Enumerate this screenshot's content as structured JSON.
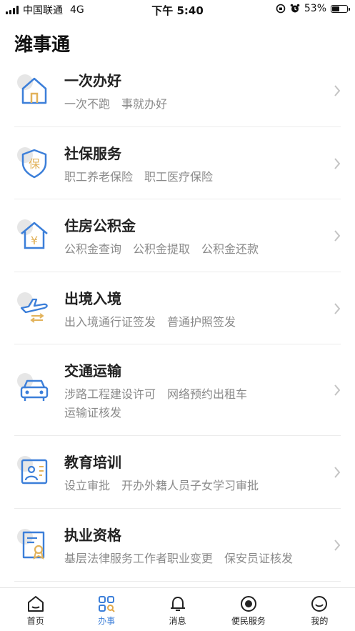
{
  "status_bar": {
    "carrier": "中国联通",
    "network": "4G",
    "time": "下午 5:40",
    "battery_percent": "53%",
    "battery_level": 0.53
  },
  "page": {
    "title": "潍事通"
  },
  "services": [
    {
      "title": "一次办好",
      "icon": "home-icon",
      "tags": [
        "一次不跑",
        "事就办好"
      ]
    },
    {
      "title": "社保服务",
      "icon": "shield-icon",
      "icon_text": "保",
      "tags": [
        "职工养老保险",
        "职工医疗保险"
      ]
    },
    {
      "title": "住房公积金",
      "icon": "house-yen-icon",
      "icon_text": "¥",
      "tags": [
        "公积金查询",
        "公积金提取",
        "公积金还款"
      ]
    },
    {
      "title": "出境入境",
      "icon": "airplane-icon",
      "tags": [
        "出入境通行证签发",
        "普通护照签发"
      ]
    },
    {
      "title": "交通运输",
      "icon": "car-icon",
      "tags": [
        "涉路工程建设许可",
        "网络预约出租车",
        "运输证核发"
      ]
    },
    {
      "title": "教育培训",
      "icon": "education-board-icon",
      "tags": [
        "设立审批",
        "开办外籍人员子女学习审批"
      ]
    },
    {
      "title": "执业资格",
      "icon": "certificate-icon",
      "tags": [
        "基层法律服务工作者职业变更",
        "保安员证核发"
      ]
    }
  ],
  "tabbar": [
    {
      "label": "首页",
      "icon": "home-tab-icon",
      "active": false
    },
    {
      "label": "办事",
      "icon": "services-grid-icon",
      "active": true
    },
    {
      "label": "消息",
      "icon": "bell-icon",
      "active": false
    },
    {
      "label": "便民服务",
      "icon": "target-circle-icon",
      "active": false
    },
    {
      "label": "我的",
      "icon": "smiley-face-icon",
      "active": false
    }
  ],
  "colors": {
    "accent": "#3c7fd9",
    "icon_gold": "#e2b25a",
    "tag_gray": "#8a8a8a"
  }
}
